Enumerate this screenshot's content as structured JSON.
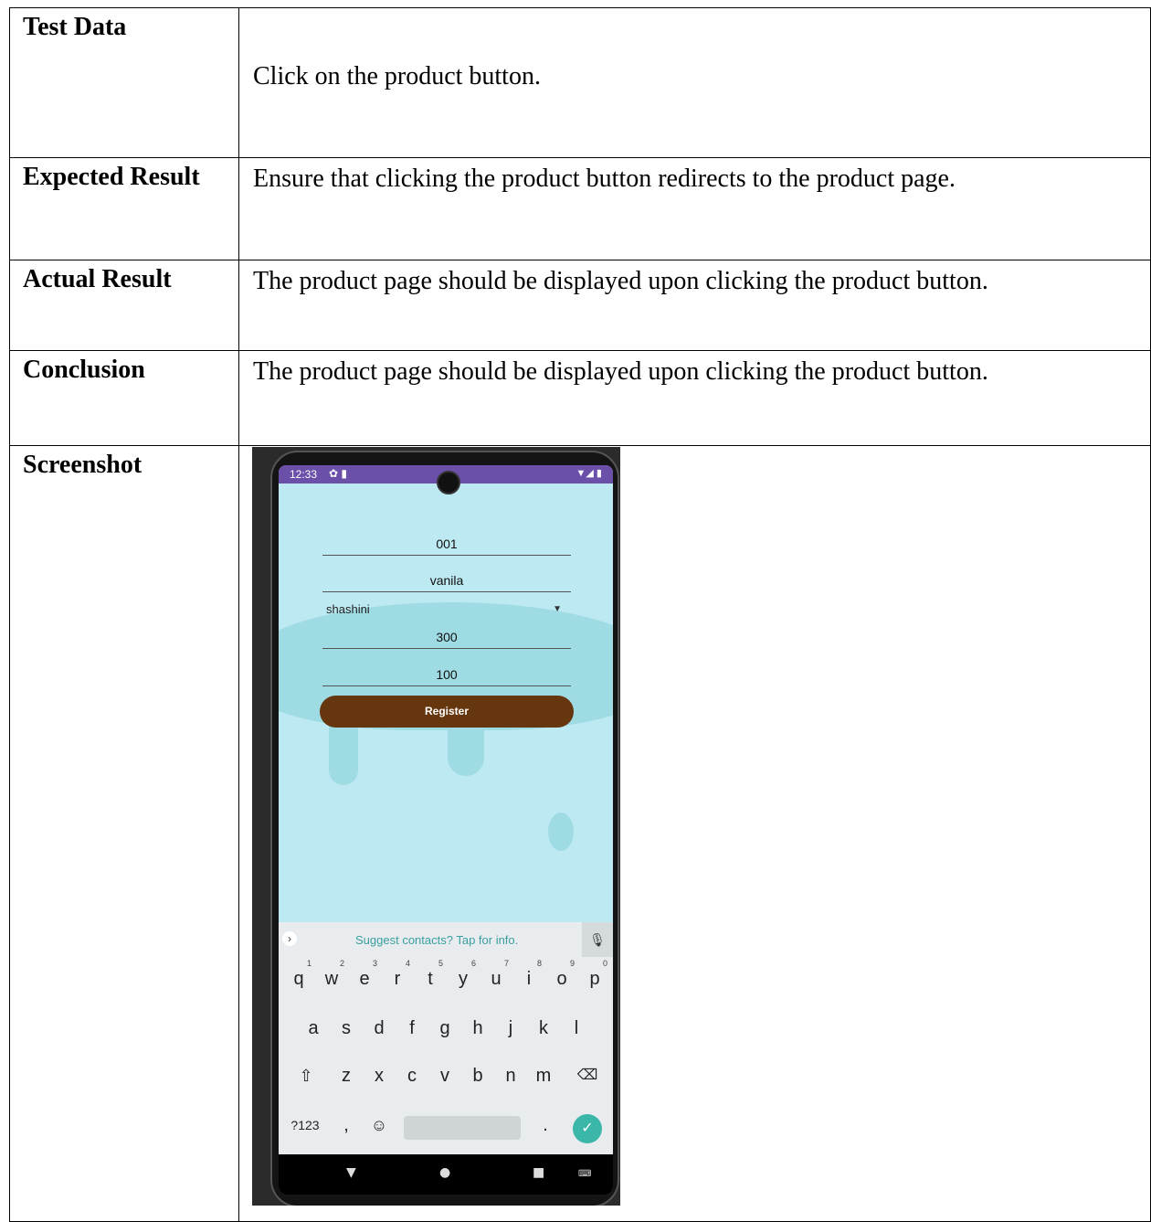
{
  "table": {
    "rows": [
      {
        "label": "Test Data",
        "value": "Click on the product button."
      },
      {
        "label": "Expected Result",
        "value": "Ensure that clicking the product button redirects to the product page."
      },
      {
        "label": "Actual Result",
        "value": "The product page should be displayed upon clicking the product button."
      },
      {
        "label": "Conclusion",
        "value": "The product page should be displayed upon clicking the product button."
      },
      {
        "label": "Screenshot",
        "value": ""
      }
    ]
  },
  "phone": {
    "status_time": "12:33",
    "status_left_icons": "✿ ▮",
    "status_right_icons": "▼◢ ▮",
    "fields": {
      "product_id": "001",
      "product_name": "vanila",
      "supplier": "shashini",
      "price": "300",
      "quantity": "100"
    },
    "register_label": "Register",
    "keyboard": {
      "suggest_text": "Suggest contacts? Tap for info.",
      "row1": [
        "q",
        "w",
        "e",
        "r",
        "t",
        "y",
        "u",
        "i",
        "o",
        "p"
      ],
      "row1_hints": [
        "1",
        "2",
        "3",
        "4",
        "5",
        "6",
        "7",
        "8",
        "9",
        "0"
      ],
      "row2": [
        "a",
        "s",
        "d",
        "f",
        "g",
        "h",
        "j",
        "k",
        "l"
      ],
      "row3": [
        "z",
        "x",
        "c",
        "v",
        "b",
        "n",
        "m"
      ],
      "symbols_label": "?123",
      "comma": ",",
      "period": "."
    },
    "colors": {
      "status_bar": "#6a50a8",
      "screen_bg": "#bde9f3",
      "register_button": "#66360f",
      "enter_key": "#3ab7a8"
    }
  }
}
